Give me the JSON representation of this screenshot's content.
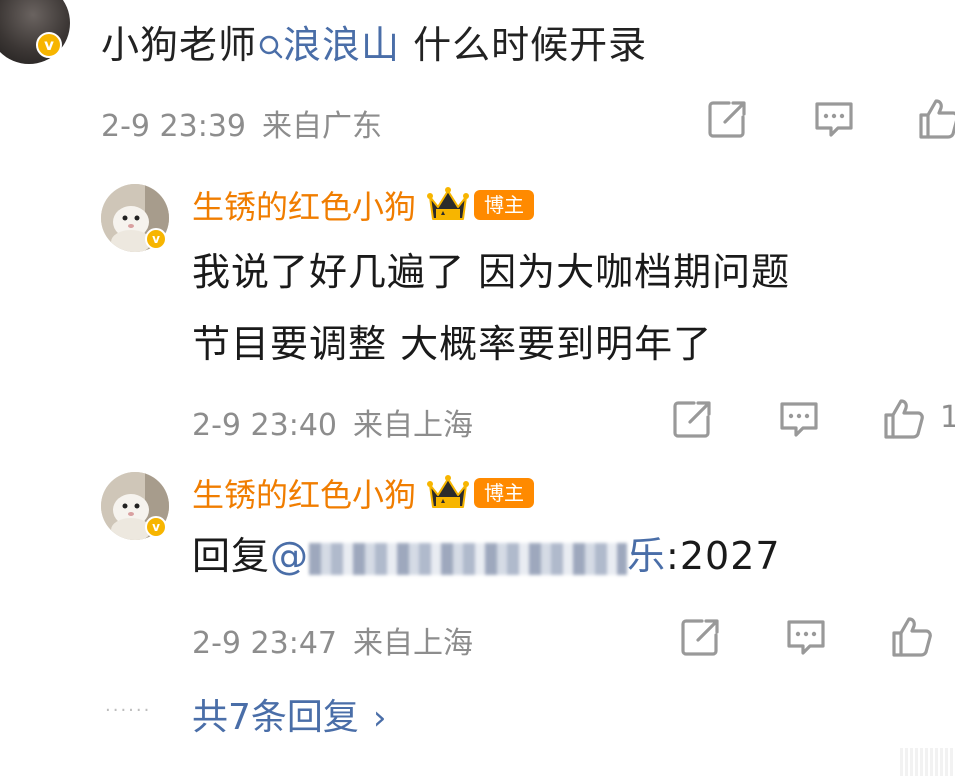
{
  "top_comment": {
    "user_badge": "v",
    "text_prefix": "小狗老师",
    "topic_icon": "search-icon",
    "topic": "浪浪山",
    "text_suffix": " 什么时候开录",
    "time": "2-9 23:39",
    "location": "来自广东"
  },
  "replies": [
    {
      "username": "生锈的红色小狗",
      "badge": "v",
      "tag": "博主",
      "text_line1": "我说了好几遍了 因为大咖档期问题",
      "text_line2": "节目要调整 大概率要到明年了",
      "time": "2-9 23:40",
      "location": "来自上海",
      "like_count": "1"
    },
    {
      "username": "生锈的红色小狗",
      "badge": "v",
      "tag": "博主",
      "reply_prefix": "回复",
      "mention_start": "@",
      "mention_end": "乐",
      "reply_suffix": ":2027",
      "time": "2-9 23:47",
      "location": "来自上海"
    }
  ],
  "more_replies": {
    "label": "共7条回复",
    "chevron": "›"
  },
  "colors": {
    "link": "#4a6ea8",
    "username": "#f07d00",
    "meta": "#8d8d8d",
    "tag_bg": "#ff8a00",
    "verified": "#f7b500"
  },
  "icons": [
    "share-icon",
    "comment-icon",
    "like-icon",
    "crown-icon",
    "search-icon",
    "chevron-right-icon"
  ]
}
